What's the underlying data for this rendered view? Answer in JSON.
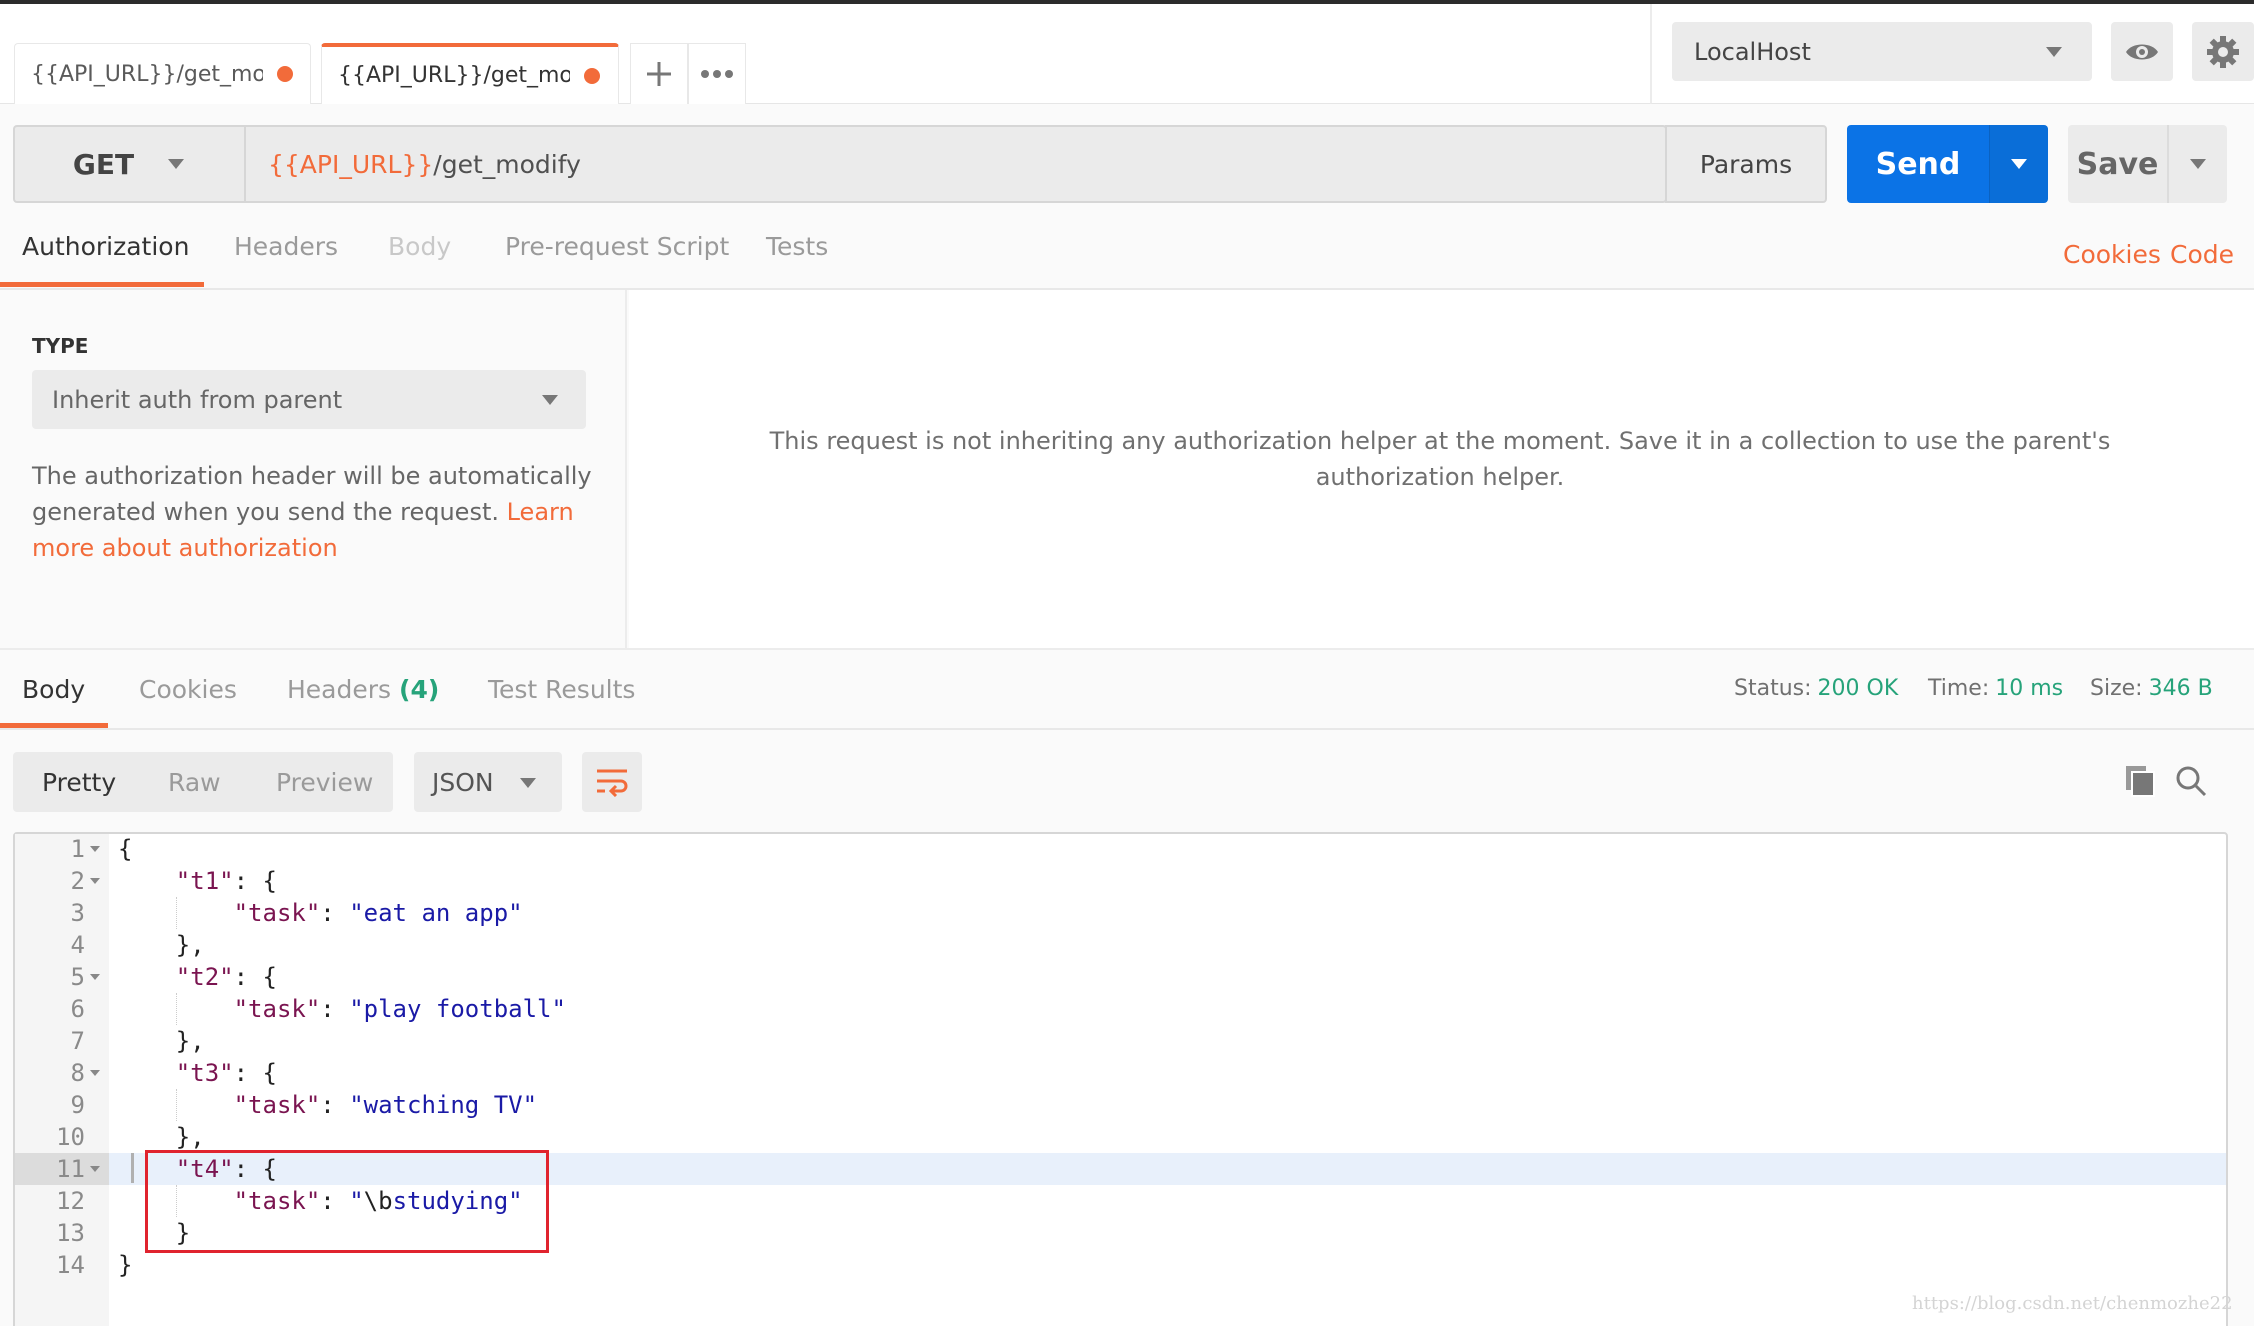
{
  "tabs": [
    {
      "label": "{{API_URL}}/get_modify",
      "unsaved": true,
      "active": false
    },
    {
      "label": "{{API_URL}}/get_modify",
      "unsaved": true,
      "active": true
    }
  ],
  "tab_actions": {
    "new_tab": "+",
    "more": "•••"
  },
  "environment": {
    "selected": "LocalHost"
  },
  "icons": {
    "eye": "eye-icon",
    "settings": "gear-icon",
    "copy": "copy-icon",
    "search": "search-icon",
    "wrap": "wrap-lines-icon"
  },
  "request": {
    "method": "GET",
    "url_variable": "{{API_URL}}",
    "url_path": "/get_modify",
    "params_label": "Params",
    "send_label": "Send",
    "save_label": "Save"
  },
  "request_tabs": [
    {
      "label": "Authorization",
      "state": "active"
    },
    {
      "label": "Headers",
      "state": "normal"
    },
    {
      "label": "Body",
      "state": "disabled"
    },
    {
      "label": "Pre-request Script",
      "state": "normal"
    },
    {
      "label": "Tests",
      "state": "normal"
    }
  ],
  "request_links": {
    "cookies": "Cookies",
    "code": "Code"
  },
  "authorization": {
    "type_label": "TYPE",
    "type_value": "Inherit auth from parent",
    "description": "The authorization header will be automatically generated when you send the request. ",
    "learn_more": "Learn more about authorization",
    "message": "This request is not inheriting any authorization helper at the moment. Save it in a collection to use the parent's authorization helper."
  },
  "response_tabs": [
    {
      "label": "Body",
      "state": "active"
    },
    {
      "label": "Cookies",
      "state": "normal"
    },
    {
      "label": "Headers",
      "count": "(4)",
      "state": "normal"
    },
    {
      "label": "Test Results",
      "state": "normal"
    }
  ],
  "response_status": {
    "status_label": "Status:",
    "status_value": "200 OK",
    "time_label": "Time:",
    "time_value": "10 ms",
    "size_label": "Size:",
    "size_value": "346 B"
  },
  "response_view": {
    "modes": [
      "Pretty",
      "Raw",
      "Preview"
    ],
    "active_mode": "Pretty",
    "format": "JSON"
  },
  "code_lines": [
    {
      "n": "1",
      "fold": true,
      "tokens": [
        {
          "t": "{",
          "c": "p"
        }
      ]
    },
    {
      "n": "2",
      "fold": true,
      "tokens": [
        {
          "t": "    ",
          "c": "p"
        },
        {
          "t": "\"t1\"",
          "c": "k"
        },
        {
          "t": ": {",
          "c": "p"
        }
      ]
    },
    {
      "n": "3",
      "fold": false,
      "tokens": [
        {
          "t": "        ",
          "c": "p"
        },
        {
          "t": "\"task\"",
          "c": "k"
        },
        {
          "t": ": ",
          "c": "p"
        },
        {
          "t": "\"eat an app\"",
          "c": "s"
        }
      ]
    },
    {
      "n": "4",
      "fold": false,
      "tokens": [
        {
          "t": "    },",
          "c": "p"
        }
      ]
    },
    {
      "n": "5",
      "fold": true,
      "tokens": [
        {
          "t": "    ",
          "c": "p"
        },
        {
          "t": "\"t2\"",
          "c": "k"
        },
        {
          "t": ": {",
          "c": "p"
        }
      ]
    },
    {
      "n": "6",
      "fold": false,
      "tokens": [
        {
          "t": "        ",
          "c": "p"
        },
        {
          "t": "\"task\"",
          "c": "k"
        },
        {
          "t": ": ",
          "c": "p"
        },
        {
          "t": "\"play football\"",
          "c": "s"
        }
      ]
    },
    {
      "n": "7",
      "fold": false,
      "tokens": [
        {
          "t": "    },",
          "c": "p"
        }
      ]
    },
    {
      "n": "8",
      "fold": true,
      "tokens": [
        {
          "t": "    ",
          "c": "p"
        },
        {
          "t": "\"t3\"",
          "c": "k"
        },
        {
          "t": ": {",
          "c": "p"
        }
      ]
    },
    {
      "n": "9",
      "fold": false,
      "tokens": [
        {
          "t": "        ",
          "c": "p"
        },
        {
          "t": "\"task\"",
          "c": "k"
        },
        {
          "t": ": ",
          "c": "p"
        },
        {
          "t": "\"watching TV\"",
          "c": "s"
        }
      ]
    },
    {
      "n": "10",
      "fold": false,
      "tokens": [
        {
          "t": "    },",
          "c": "p"
        }
      ]
    },
    {
      "n": "11",
      "fold": true,
      "highlight": true,
      "tokens": [
        {
          "t": "    ",
          "c": "p"
        },
        {
          "t": "\"t4\"",
          "c": "k"
        },
        {
          "t": ": {",
          "c": "p"
        }
      ]
    },
    {
      "n": "12",
      "fold": false,
      "tokens": [
        {
          "t": "        ",
          "c": "p"
        },
        {
          "t": "\"task\"",
          "c": "k"
        },
        {
          "t": ": ",
          "c": "p"
        },
        {
          "t": "\"",
          "c": "s"
        },
        {
          "t": "\\b",
          "c": "esc"
        },
        {
          "t": "studying\"",
          "c": "s"
        }
      ]
    },
    {
      "n": "13",
      "fold": false,
      "tokens": [
        {
          "t": "    }",
          "c": "p"
        }
      ]
    },
    {
      "n": "14",
      "fold": false,
      "tokens": [
        {
          "t": "}",
          "c": "p"
        }
      ]
    }
  ],
  "watermark": "https://blog.csdn.net/chenmozhe22"
}
